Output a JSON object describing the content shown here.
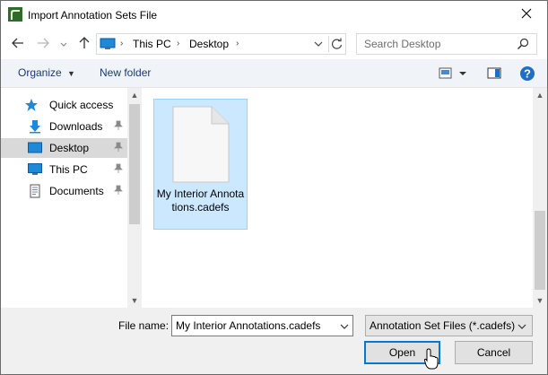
{
  "window": {
    "title": "Import Annotation Sets File",
    "close_icon": "close-icon",
    "app_icon": "chief-architect-icon"
  },
  "address": {
    "crumbs": [
      "This PC",
      "Desktop"
    ],
    "search_placeholder": "Search Desktop"
  },
  "toolbar": {
    "organize_label": "Organize",
    "new_folder_label": "New folder"
  },
  "nav": {
    "quick_access": "Quick access",
    "items": [
      {
        "label": "Downloads",
        "icon": "download-arrow-icon",
        "pinned": true
      },
      {
        "label": "Desktop",
        "icon": "desktop-icon",
        "pinned": true,
        "selected": true
      },
      {
        "label": "This PC",
        "icon": "computer-icon",
        "pinned": true
      },
      {
        "label": "Documents",
        "icon": "documents-icon",
        "pinned": true
      }
    ]
  },
  "files": [
    {
      "name": "My Interior Annotations.cadefs",
      "icon": "blank-document-icon",
      "selected": true
    }
  ],
  "footer": {
    "file_name_label": "File name:",
    "file_name_value": "My Interior Annotations.cadefs",
    "file_type_value": "Annotation Set Files (*.cadefs)",
    "open_label": "Open",
    "cancel_label": "Cancel"
  },
  "colors": {
    "accent": "#0078d7",
    "selection_fill": "#cce8ff",
    "selection_border": "#99d1ff",
    "command_bar": "#f0f4f9",
    "link_text": "#1a3a70"
  }
}
